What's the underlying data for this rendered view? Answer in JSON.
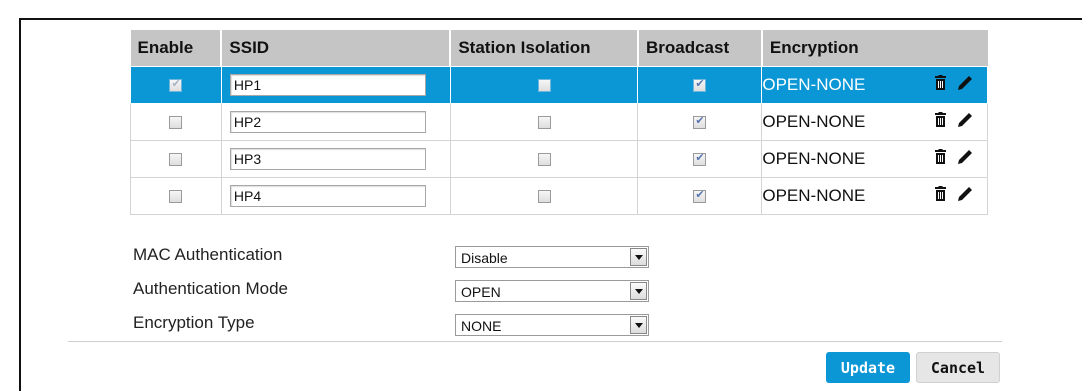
{
  "table": {
    "headers": {
      "enable": "Enable",
      "ssid": "SSID",
      "station_isolation": "Station Isolation",
      "broadcast": "Broadcast",
      "encryption": "Encryption"
    },
    "rows": [
      {
        "enabled": true,
        "ssid": "HP1",
        "station_isolation": false,
        "broadcast": true,
        "encryption": "OPEN-NONE",
        "selected": true
      },
      {
        "enabled": false,
        "ssid": "HP2",
        "station_isolation": false,
        "broadcast": true,
        "encryption": "OPEN-NONE",
        "selected": false
      },
      {
        "enabled": false,
        "ssid": "HP3",
        "station_isolation": false,
        "broadcast": true,
        "encryption": "OPEN-NONE",
        "selected": false
      },
      {
        "enabled": false,
        "ssid": "HP4",
        "station_isolation": false,
        "broadcast": true,
        "encryption": "OPEN-NONE",
        "selected": false
      }
    ],
    "row_icons": [
      "trash-icon",
      "pencil-icon"
    ]
  },
  "settings": {
    "mac_auth": {
      "label": "MAC Authentication",
      "value": "Disable"
    },
    "auth_mode": {
      "label": "Authentication Mode",
      "value": "OPEN"
    },
    "enc_type": {
      "label": "Encryption Type",
      "value": "NONE"
    }
  },
  "buttons": {
    "update": "Update",
    "cancel": "Cancel"
  },
  "colors": {
    "accent": "#0b96d6",
    "header_bg": "#c5c5c5",
    "cancel_bg": "#e6e6e6"
  }
}
